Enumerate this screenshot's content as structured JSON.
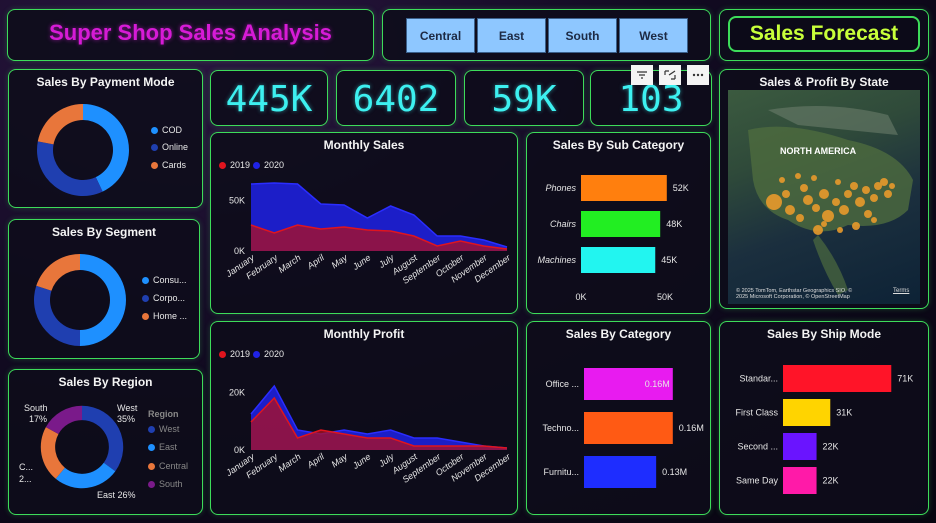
{
  "header": {
    "title": "Super Shop Sales Analysis",
    "region_buttons": [
      "Central",
      "East",
      "South",
      "West"
    ],
    "forecast_button": "Sales Forecast"
  },
  "kpis": [
    "445K",
    "6402",
    "59K",
    "103"
  ],
  "payment_mode": {
    "title": "Sales By Payment Mode",
    "legend": [
      "COD",
      "Online",
      "Cards"
    ],
    "colors": [
      "#1e90ff",
      "#1f3fb0",
      "#e8763b"
    ],
    "values": [
      43,
      35,
      22
    ]
  },
  "segment": {
    "title": "Sales By Segment",
    "legend": [
      "Consu...",
      "Corpo...",
      "Home ..."
    ],
    "colors": [
      "#1e90ff",
      "#1f3fb0",
      "#e8763b"
    ],
    "values": [
      50,
      30,
      20
    ]
  },
  "region": {
    "title": "Sales By Region",
    "legend_title": "Region",
    "legend": [
      "West",
      "East",
      "Central",
      "South"
    ],
    "colors": [
      "#1f3fb0",
      "#1e90ff",
      "#e8763b",
      "#7a1a8a"
    ],
    "values": [
      35,
      26,
      22,
      17
    ],
    "labels": {
      "south": "South",
      "south_pct": "17%",
      "west": "West",
      "west_pct": "35%",
      "central": "C...",
      "central_pct": "2...",
      "east": "East 26%"
    }
  },
  "monthly_sales": {
    "title": "Monthly Sales",
    "legend": [
      "2019",
      "2020"
    ],
    "legend_colors": [
      "#e0141e",
      "#1f22e6"
    ],
    "y_ticks": [
      "50K",
      "0K"
    ]
  },
  "monthly_profit": {
    "title": "Monthly Profit",
    "legend": [
      "2019",
      "2020"
    ],
    "legend_colors": [
      "#e0141e",
      "#1f22e6"
    ],
    "y_ticks": [
      "20K",
      "0K"
    ]
  },
  "months": [
    "January",
    "February",
    "March",
    "April",
    "May",
    "June",
    "July",
    "August",
    "September",
    "October",
    "November",
    "December"
  ],
  "sub_category": {
    "title": "Sales By Sub Category",
    "items": [
      "Phones",
      "Chairs",
      "Machines"
    ],
    "labels": [
      "52K",
      "48K",
      "45K"
    ],
    "x_ticks": [
      "0K",
      "50K"
    ]
  },
  "category": {
    "title": "Sales By Category",
    "items": [
      "Office ...",
      "Techno...",
      "Furnitu..."
    ],
    "labels": [
      "0.16M",
      "0.16M",
      "0.13M"
    ]
  },
  "ship_mode": {
    "title": "Sales By Ship Mode",
    "items": [
      "Standar...",
      "First Class",
      "Second ...",
      "Same Day"
    ],
    "labels": [
      "71K",
      "31K",
      "22K",
      "22K"
    ]
  },
  "state_map": {
    "title": "Sales & Profit By State",
    "region_label": "NORTH AMERICA",
    "attribution_1": "© 2025 TomTom, Earthstar Geographics SIO, ©",
    "attribution_2": "2025 Microsoft Corporation, © OpenStreetMap",
    "terms": "Terms"
  },
  "chart_data": [
    {
      "type": "area",
      "title": "Monthly Sales",
      "x": [
        "January",
        "February",
        "March",
        "April",
        "May",
        "June",
        "July",
        "August",
        "September",
        "October",
        "November",
        "December"
      ],
      "series": [
        {
          "name": "2019",
          "values": [
            26,
            18,
            26,
            22,
            24,
            21,
            20,
            15,
            5,
            10,
            5,
            2
          ]
        },
        {
          "name": "2020",
          "values": [
            67,
            68,
            67,
            47,
            46,
            33,
            45,
            36,
            15,
            15,
            11,
            4
          ]
        }
      ],
      "ylim": [
        0,
        70
      ]
    },
    {
      "type": "area",
      "title": "Monthly Profit",
      "x": [
        "January",
        "February",
        "March",
        "April",
        "May",
        "June",
        "July",
        "August",
        "September",
        "October",
        "November",
        "December"
      ],
      "series": [
        {
          "name": "2019",
          "values": [
            7,
            13,
            3,
            5,
            4,
            3,
            3,
            1,
            1,
            1,
            1,
            0.5
          ]
        },
        {
          "name": "2020",
          "values": [
            9,
            16,
            5,
            4,
            5,
            4,
            5,
            3,
            3,
            2,
            1,
            0.5
          ]
        }
      ],
      "ylim": [
        0,
        20
      ]
    },
    {
      "type": "bar",
      "title": "Sales By Sub Category",
      "categories": [
        "Phones",
        "Chairs",
        "Machines"
      ],
      "values": [
        52000,
        48000,
        45000
      ],
      "colors": [
        "#ff7f0e",
        "#22ee22",
        "#22f5f0"
      ],
      "xlim": [
        0,
        60000
      ]
    },
    {
      "type": "bar",
      "title": "Sales By Category",
      "categories": [
        "Office ...",
        "Techno...",
        "Furnitu..."
      ],
      "values": [
        160000,
        160000,
        130000
      ],
      "colors": [
        "#e81bf0",
        "#ff5a14",
        "#1e2dff"
      ],
      "xlim": [
        0,
        200000
      ]
    },
    {
      "type": "bar",
      "title": "Sales By Ship Mode",
      "categories": [
        "Standar...",
        "First Class",
        "Second ...",
        "Same Day"
      ],
      "values": [
        71000,
        31000,
        22000,
        22000
      ],
      "colors": [
        "#ff1428",
        "#ffd400",
        "#6a14ff",
        "#ff1aa8"
      ],
      "xlim": [
        0,
        80000
      ]
    }
  ]
}
